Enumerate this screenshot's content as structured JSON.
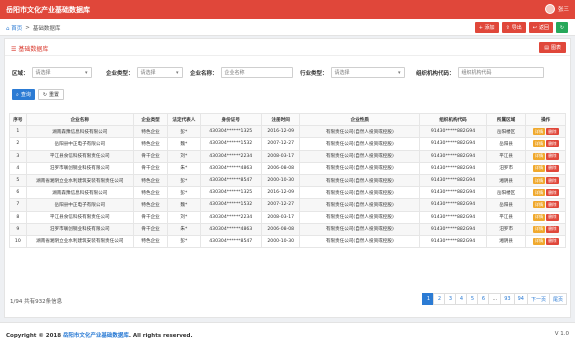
{
  "app": {
    "title": "岳阳市文化产业基础数据库",
    "user": "张三"
  },
  "crumb": {
    "home": "首页",
    "sep": ">",
    "current": "基础数据库"
  },
  "toolbar": {
    "add": "+ 添加",
    "export": "导出",
    "back": "返回",
    "refresh_icon": "refresh-icon"
  },
  "panel": {
    "title": "基础数据库",
    "chart_btn": "图表"
  },
  "filters": {
    "region": {
      "label": "区域：",
      "value": "请选择"
    },
    "type": {
      "label": "企业类型：",
      "value": "请选择"
    },
    "name": {
      "label": "企业名称：",
      "placeholder": "企业名称"
    },
    "industry": {
      "label": "行业类型：",
      "value": "请选择"
    },
    "org_code": {
      "label": "组织机构代码：",
      "placeholder": "组织机构代码"
    }
  },
  "search": {
    "query": "查询",
    "reset": "重置"
  },
  "table": {
    "headers": [
      "序号",
      "企业名称",
      "企业类型",
      "法定代表人",
      "身份证号",
      "注册时间",
      "企业性质",
      "组织机构代码",
      "所属区域",
      "操作"
    ],
    "actions": {
      "edit": "详情",
      "delete": "删除"
    },
    "rows": [
      [
        "1",
        "湖南森豫信息科技有限公司",
        "特色企业",
        "彭*",
        "430304******1325",
        "2016-12-09",
        "有限责任公司(自然人投资或控股)",
        "91430*****882G94",
        "岳阳楼区"
      ],
      [
        "2",
        "岳阳县中正电子有限公司",
        "特色企业",
        "魏*",
        "430304******1532",
        "2007-12-27",
        "有限责任公司(自然人投资或控股)",
        "91430*****882G94",
        "岳阳县"
      ],
      [
        "3",
        "平江县食信科技有限责任公司",
        "骨干企业",
        "刘*",
        "430304******2234",
        "2008-03-17",
        "有限责任公司(自然人投资或控股)",
        "91430*****882G94",
        "平江县"
      ],
      [
        "4",
        "汨罗市联创钢业科技有限公司",
        "骨干企业",
        "朱*",
        "430304******4863",
        "2006-08-08",
        "有限责任公司(自然人投资或控股)",
        "91430*****882G94",
        "汨罗市"
      ],
      [
        "5",
        "湖南省湘阴立业水利建筑安装有限责任公司",
        "特色企业",
        "彭*",
        "430304******8547",
        "2000-10-30",
        "有限责任公司(自然人投资或控股)",
        "91430*****882G94",
        "湘阴县"
      ],
      [
        "6",
        "湖南森豫信息科技有限公司",
        "特色企业",
        "彭*",
        "430304******1325",
        "2016-12-09",
        "有限责任公司(自然人投资或控股)",
        "91430*****882G94",
        "岳阳楼区"
      ],
      [
        "7",
        "岳阳县中正电子有限公司",
        "特色企业",
        "魏*",
        "430304******1532",
        "2007-12-27",
        "有限责任公司(自然人投资或控股)",
        "91430*****882G94",
        "岳阳县"
      ],
      [
        "8",
        "平江县食信科技有限责任公司",
        "骨干企业",
        "刘*",
        "430304******2234",
        "2008-03-17",
        "有限责任公司(自然人投资或控股)",
        "91430*****882G94",
        "平江县"
      ],
      [
        "9",
        "汨罗市联创钢业科技有限公司",
        "骨干企业",
        "朱*",
        "430304******4863",
        "2006-08-08",
        "有限责任公司(自然人投资或控股)",
        "91430*****882G94",
        "汨罗市"
      ],
      [
        "10",
        "湖南省湘阴立业水利建筑安装有限责任公司",
        "特色企业",
        "彭*",
        "430304******8547",
        "2000-10-30",
        "有限责任公司(自然人投资或控股)",
        "91430*****882G94",
        "湘阴县"
      ]
    ]
  },
  "pagination": {
    "info": "1/94 共有932条信息",
    "pages": [
      "1",
      "2",
      "3",
      "4",
      "5",
      "6",
      "...",
      "93",
      "94",
      "下一页",
      "尾页"
    ],
    "current": "1"
  },
  "footer": {
    "copyright_prefix": "Copyright © 2018",
    "link": "岳阳市文化产业基础数据库",
    "suffix": ". All rights reserved.",
    "version": "V 1.0"
  }
}
